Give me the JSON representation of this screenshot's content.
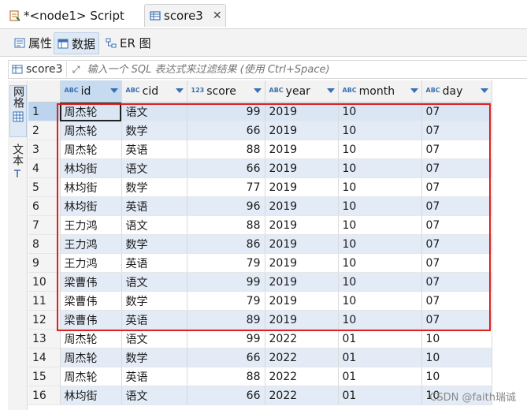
{
  "editor_tabs": [
    {
      "label": "*<node1> Script",
      "icon": "script-icon"
    },
    {
      "label": "score3",
      "icon": "table-icon",
      "close": "✕"
    }
  ],
  "view_tabs": [
    {
      "label": "属性",
      "icon": "properties-icon"
    },
    {
      "label": "数据",
      "icon": "data-icon",
      "active": true
    },
    {
      "label": "ER 图",
      "icon": "er-diagram-icon"
    }
  ],
  "filter": {
    "table_name": "score3",
    "placeholder": "输入一个 SQL 表达式来过滤结果 (使用 Ctrl+Space)"
  },
  "side_tabs": [
    {
      "label": "网格",
      "active": true
    },
    {
      "label": "文本",
      "active": false
    }
  ],
  "columns": [
    {
      "type": "ABC",
      "name": "id"
    },
    {
      "type": "ABC",
      "name": "cid"
    },
    {
      "type": "123",
      "name": "score"
    },
    {
      "type": "ABC",
      "name": "year"
    },
    {
      "type": "ABC",
      "name": "month"
    },
    {
      "type": "ABC",
      "name": "day"
    }
  ],
  "rows": [
    {
      "n": "1",
      "id": "周杰轮",
      "cid": "语文",
      "score": "99",
      "year": "2019",
      "month": "10",
      "day": "07"
    },
    {
      "n": "2",
      "id": "周杰轮",
      "cid": "数学",
      "score": "66",
      "year": "2019",
      "month": "10",
      "day": "07"
    },
    {
      "n": "3",
      "id": "周杰轮",
      "cid": "英语",
      "score": "88",
      "year": "2019",
      "month": "10",
      "day": "07"
    },
    {
      "n": "4",
      "id": "林均街",
      "cid": "语文",
      "score": "66",
      "year": "2019",
      "month": "10",
      "day": "07"
    },
    {
      "n": "5",
      "id": "林均街",
      "cid": "数学",
      "score": "77",
      "year": "2019",
      "month": "10",
      "day": "07"
    },
    {
      "n": "6",
      "id": "林均街",
      "cid": "英语",
      "score": "96",
      "year": "2019",
      "month": "10",
      "day": "07"
    },
    {
      "n": "7",
      "id": "王力鸿",
      "cid": "语文",
      "score": "88",
      "year": "2019",
      "month": "10",
      "day": "07"
    },
    {
      "n": "8",
      "id": "王力鸿",
      "cid": "数学",
      "score": "86",
      "year": "2019",
      "month": "10",
      "day": "07"
    },
    {
      "n": "9",
      "id": "王力鸿",
      "cid": "英语",
      "score": "79",
      "year": "2019",
      "month": "10",
      "day": "07"
    },
    {
      "n": "10",
      "id": "梁曹伟",
      "cid": "语文",
      "score": "99",
      "year": "2019",
      "month": "10",
      "day": "07"
    },
    {
      "n": "11",
      "id": "梁曹伟",
      "cid": "数学",
      "score": "79",
      "year": "2019",
      "month": "10",
      "day": "07"
    },
    {
      "n": "12",
      "id": "梁曹伟",
      "cid": "英语",
      "score": "89",
      "year": "2019",
      "month": "10",
      "day": "07"
    },
    {
      "n": "13",
      "id": "周杰轮",
      "cid": "语文",
      "score": "99",
      "year": "2022",
      "month": "01",
      "day": "10"
    },
    {
      "n": "14",
      "id": "周杰轮",
      "cid": "数学",
      "score": "66",
      "year": "2022",
      "month": "01",
      "day": "10"
    },
    {
      "n": "15",
      "id": "周杰轮",
      "cid": "英语",
      "score": "88",
      "year": "2022",
      "month": "01",
      "day": "10"
    },
    {
      "n": "16",
      "id": "林均街",
      "cid": "语文",
      "score": "66",
      "year": "2022",
      "month": "01",
      "day": "10"
    }
  ],
  "watermark": "CSDN @faith瑞诚",
  "colors": {
    "highlight": "#e02020",
    "header_sorted": "#c6dbf0",
    "stripe": "#e3ebf6",
    "accent": "#3a6fb3"
  }
}
